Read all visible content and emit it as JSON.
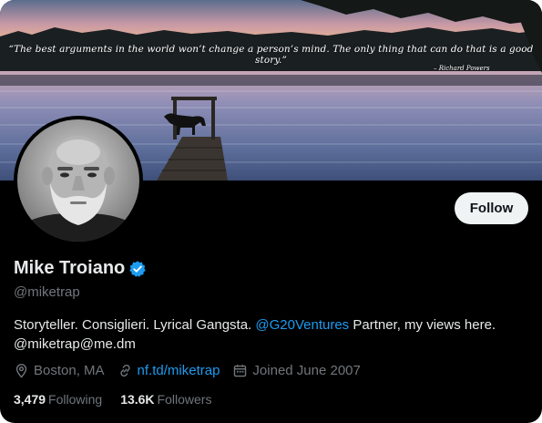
{
  "banner": {
    "quote": "“The best arguments in the world won’t change a person’s mind. The only thing that can do that is a good story.”",
    "quote_author": "– Richard Powers"
  },
  "profile": {
    "name": "Mike Troiano",
    "handle": "@miketrap",
    "bio_part1": "Storyteller. Consiglieri. Lyrical Gangsta. ",
    "bio_mention": "@G20Ventures",
    "bio_part2": " Partner, my views here.",
    "bio_line2": "@miketrap@me.dm",
    "location": "Boston, MA",
    "website": "nf.td/miketrap",
    "joined": "Joined June 2007"
  },
  "stats": {
    "following_count": "3,479",
    "following_label": "Following",
    "followers_count": "13.6K",
    "followers_label": "Followers"
  },
  "actions": {
    "follow_label": "Follow"
  },
  "colors": {
    "background": "#000000",
    "primary_text": "#e7e9ea",
    "secondary_text": "#71767b",
    "accent": "#1d9bf0",
    "button_bg": "#eff3f4"
  },
  "icons": {
    "verified": "verified-badge-icon",
    "location": "location-pin-icon",
    "link": "link-icon",
    "calendar": "calendar-icon"
  }
}
